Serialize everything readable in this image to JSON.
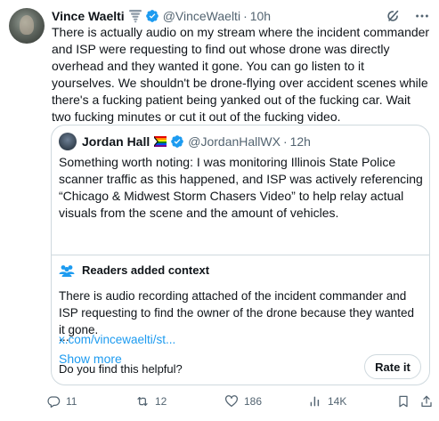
{
  "tweet": {
    "author_name": "Vince Waelti",
    "handle": "@VinceWaelti",
    "time": "10h",
    "text": "There is actually audio on my stream where the incident commander and ISP were requesting to find out whose drone was directly overhead and they wanted it gone. You can go listen to it yourselves. We shouldn't be drone-flying over accident scenes while there's a fucking patient being yanked out of the fucking car. Wait two fucking minutes or cut it out of the fucking video."
  },
  "quoted": {
    "author_name": "Jordan Hall",
    "handle": "@JordanHallWX",
    "time": "12h",
    "text": "Something worth noting: I was monitoring Illinois State Police scanner traffic as this happened, and ISP was actively referencing “Chicago & Midwest Storm Chasers Video” to help relay actual visuals from the scene and the amount of vehicles.",
    "ellipsis": "...",
    "show_more": "Show more"
  },
  "context": {
    "title": "Readers added context",
    "text": "There is audio recording attached of the incident commander and ISP requesting to find the owner of the drone because they wanted it gone.",
    "link": "x.com/vincewaelti/st...",
    "question": "Do you find this helpful?",
    "rate_label": "Rate it"
  },
  "actions": {
    "replies": "11",
    "reposts": "12",
    "likes": "186",
    "views": "14K"
  },
  "colors": {
    "accent": "#1d9bf0",
    "text_secondary": "#536471",
    "border": "#cfd9de",
    "verified": "#1d9bf0"
  },
  "icons": [
    "tornado-icon",
    "verified-badge-icon",
    "grok-icon",
    "more-icon",
    "rainbow-flag-icon",
    "people-icon",
    "reply-icon",
    "repost-icon",
    "like-icon",
    "views-icon",
    "bookmark-icon",
    "share-icon"
  ]
}
